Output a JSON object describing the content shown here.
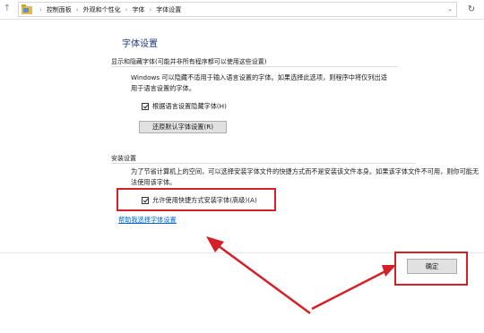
{
  "address_bar": {
    "back_icon": "back-arrow-icon",
    "forward_icon": "forward-arrow-icon",
    "up_icon": "up-arrow-icon",
    "folder_icon": "folder-icon",
    "breadcrumbs": [
      "控制面板",
      "外观和个性化",
      "字体",
      "字体设置"
    ],
    "refresh_icon": "refresh-icon"
  },
  "page": {
    "title": "字体设置"
  },
  "section_show_hide": {
    "header": "显示和隐藏字体(可能并非所有程序都可以使用这些设置)",
    "description": "Windows 可以隐藏不适用于输入语言设置的字体。如果选择此选项，则程序中将仅列出适用于语言设置的字体。",
    "checkbox_label": "根据语言设置隐藏字体(H)",
    "checkbox_checked": true,
    "restore_button": "还原默认字体设置(R)"
  },
  "section_install": {
    "header": "安装设置",
    "description": "为了节省计算机上的空间，可以选择安装字体文件的快捷方式而不是安装该文件本身。如果该字体文件不可用，则你可能无法使用该字体。",
    "checkbox_label": "允许使用快捷方式安装字体(高级)(A)",
    "checkbox_checked": true
  },
  "help_link": "帮助我选择字体设置",
  "ok_button": "确定",
  "annotation_colors": {
    "highlight": "#d62027"
  }
}
